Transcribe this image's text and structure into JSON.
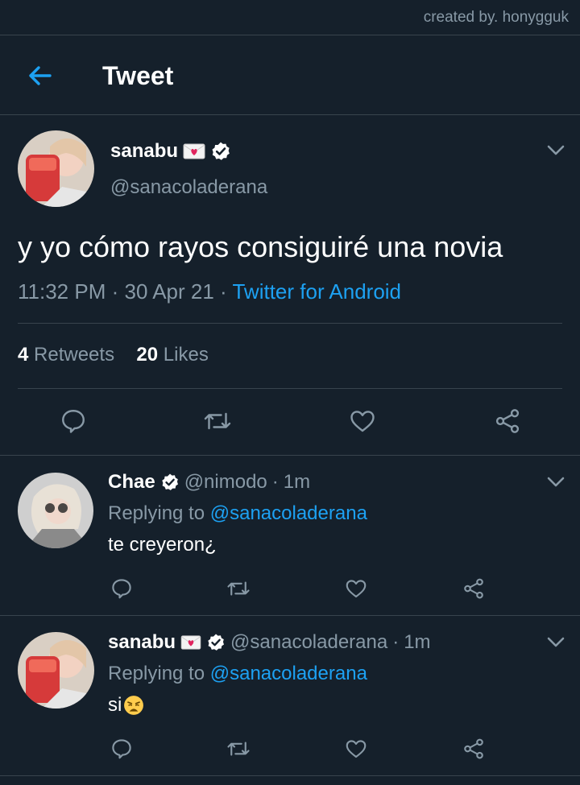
{
  "credit": "created by. honygguk",
  "header": {
    "title": "Tweet"
  },
  "main_tweet": {
    "name": "sanabu",
    "handle": "@sanacoladerana",
    "text": "y yo cómo rayos consiguiré una novia",
    "time": "11:32 PM",
    "date": "30 Apr 21",
    "source": "Twitter for Android",
    "retweets": "4",
    "retweets_label": "Retweets",
    "likes": "20",
    "likes_label": "Likes"
  },
  "replies": [
    {
      "name": "Chae",
      "handle": "@nimodo",
      "time": "1m",
      "replying_prefix": "Replying to",
      "replying_to": "@sanacoladerana",
      "text": "te creyeron¿"
    },
    {
      "name": "sanabu",
      "handle": "@sanacoladerana",
      "time": "1m",
      "replying_prefix": "Replying to",
      "replying_to": "@sanacoladerana",
      "text": "si"
    }
  ],
  "sep": "·",
  "icons": {
    "back": "back-arrow-icon",
    "verified": "verified-badge-icon",
    "chevron": "chevron-down-icon",
    "reply": "reply-icon",
    "retweet": "retweet-icon",
    "like": "heart-icon",
    "share": "share-icon",
    "love_letter": "love-letter-emoji",
    "weary": "weary-face-emoji"
  },
  "colors": {
    "background": "#15202b",
    "accent": "#1da1f2",
    "muted": "#8899a6",
    "divider": "#38444d"
  }
}
